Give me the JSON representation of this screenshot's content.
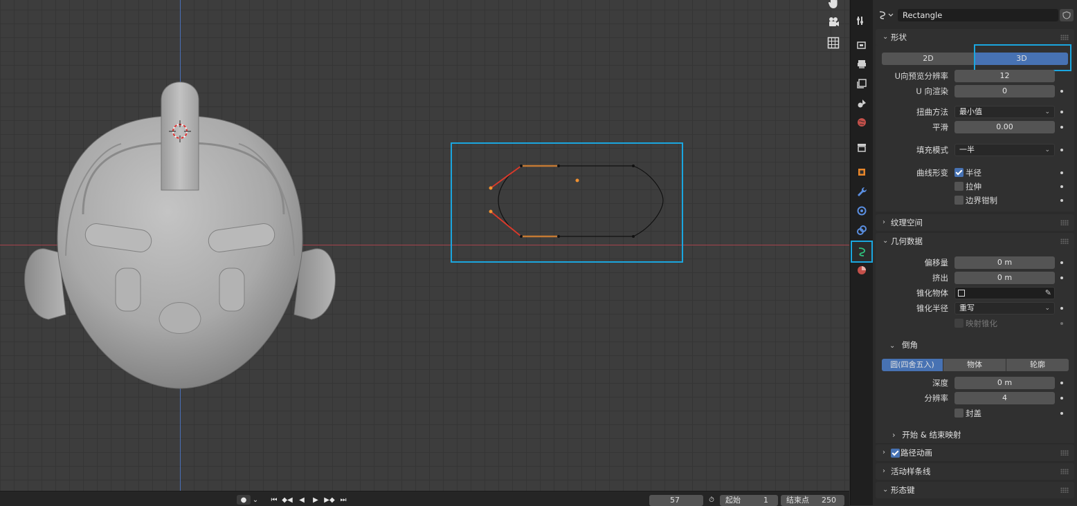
{
  "timeline": {
    "current_frame": "57",
    "start_label": "起始",
    "start_value": "1",
    "end_label": "结束点",
    "end_value": "250"
  },
  "properties": {
    "datablock_name": "Rectangle",
    "shape_panel": {
      "title": "形状",
      "dim_2d": "2D",
      "dim_3d": "3D",
      "preview_u_label": "U向预览分辨率",
      "preview_u_value": "12",
      "render_u_label": "U 向渲染",
      "render_u_value": "0",
      "twist_method_label": "扭曲方法",
      "twist_method_value": "最小值",
      "smooth_label": "平滑",
      "smooth_value": "0.00",
      "fill_mode_label": "填充模式",
      "fill_mode_value": "一半",
      "curve_deform_label": "曲线形变",
      "radius_label": "半径",
      "stretch_label": "拉伸",
      "bounds_clamp_label": "边界钳制"
    },
    "texture_space_title": "纹理空间",
    "geometry_panel": {
      "title": "几何数据",
      "offset_label": "偏移量",
      "offset_value": "0 m",
      "extrude_label": "挤出",
      "extrude_value": "0 m",
      "taper_object_label": "锥化物体",
      "taper_radius_label": "锥化半径",
      "taper_radius_value": "重写",
      "map_taper_label": "映射锥化",
      "bevel_title": "倒角",
      "bevel_round": "圆(四舍五入)",
      "bevel_object": "物体",
      "bevel_profile": "轮廓",
      "depth_label": "深度",
      "depth_value": "0 m",
      "resolution_label": "分辨率",
      "resolution_value": "4",
      "fill_caps_label": "封盖",
      "start_end_title": "开始 & 结束映射"
    },
    "path_anim_title": "路径动画",
    "active_spline_title": "活动样条线",
    "shape_keys_title": "形态键"
  },
  "colors": {
    "accent": "#4772b3",
    "highlight": "#1aa7e0"
  }
}
